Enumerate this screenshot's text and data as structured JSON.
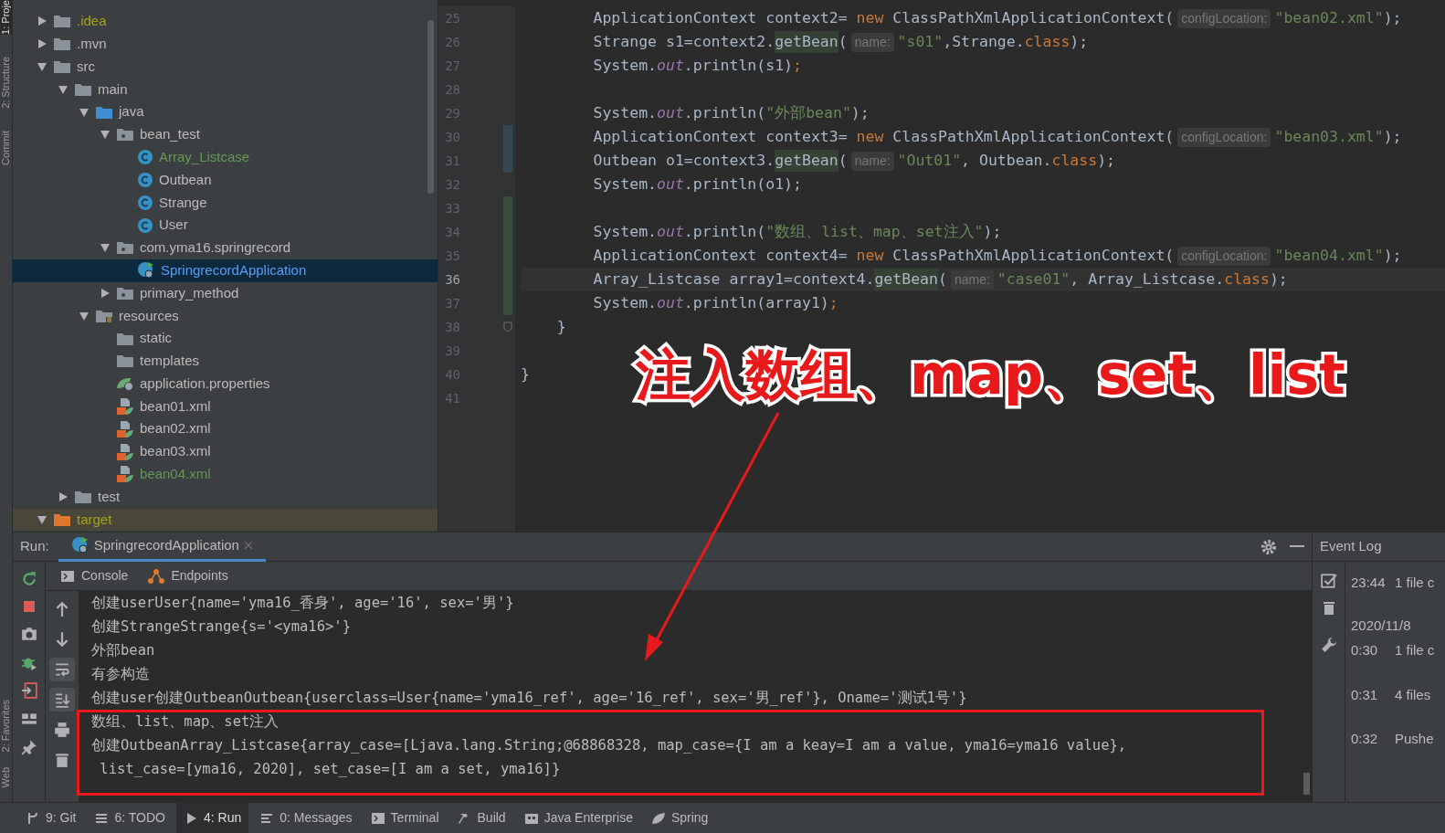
{
  "side_strip": {
    "top": [
      {
        "label": "1: Proje",
        "selected": true
      },
      {
        "label": "2: Structure",
        "selected": false
      },
      {
        "label": "Commit",
        "selected": false
      }
    ],
    "bottom": [
      {
        "label": "2: Favorites",
        "selected": false
      },
      {
        "label": "Web",
        "selected": false
      }
    ]
  },
  "project_tree": [
    {
      "label": ".idea",
      "kind": "folder",
      "color": "#a3a31d",
      "expanded": false,
      "selected": false
    },
    {
      "label": ".mvn",
      "kind": "folder",
      "color": "#bbbbbb",
      "expanded": false,
      "selected": false
    },
    {
      "label": "src",
      "kind": "folder",
      "color": "#bbbbbb",
      "expanded": true,
      "selected": false,
      "children": [
        {
          "label": "main",
          "kind": "folder",
          "color": "#bbbbbb",
          "expanded": true,
          "selected": false,
          "children": [
            {
              "label": "java",
              "kind": "source-folder",
              "color": "#bbbbbb",
              "expanded": true,
              "selected": false,
              "children": [
                {
                  "label": "bean_test",
                  "kind": "package",
                  "color": "#bbbbbb",
                  "expanded": true,
                  "selected": false,
                  "children": [
                    {
                      "label": "Array_Listcase",
                      "kind": "class",
                      "color": "#629755",
                      "selected": false
                    },
                    {
                      "label": "Outbean",
                      "kind": "class",
                      "color": "#bbbbbb",
                      "selected": false
                    },
                    {
                      "label": "Strange",
                      "kind": "class",
                      "color": "#bbbbbb",
                      "selected": false
                    },
                    {
                      "label": "User",
                      "kind": "class",
                      "color": "#bbbbbb",
                      "selected": false
                    }
                  ]
                },
                {
                  "label": "com.yma16.springrecord",
                  "kind": "package",
                  "color": "#bbbbbb",
                  "expanded": true,
                  "selected": false,
                  "children": [
                    {
                      "label": "SpringrecordApplication",
                      "kind": "spring-app",
                      "selected": true
                    }
                  ]
                },
                {
                  "label": "primary_method",
                  "kind": "package",
                  "color": "#bbbbbb",
                  "expanded": false,
                  "selected": false
                }
              ]
            },
            {
              "label": "resources",
              "kind": "resources-folder",
              "color": "#bbbbbb",
              "expanded": true,
              "selected": false,
              "children": [
                {
                  "label": "static",
                  "kind": "folder",
                  "color": "#bbbbbb",
                  "selected": false
                },
                {
                  "label": "templates",
                  "kind": "folder",
                  "color": "#bbbbbb",
                  "selected": false
                },
                {
                  "label": "application.properties",
                  "kind": "spring-properties",
                  "color": "#bbbbbb",
                  "selected": false
                },
                {
                  "label": "bean01.xml",
                  "kind": "xml",
                  "color": "#bbbbbb",
                  "selected": false
                },
                {
                  "label": "bean02.xml",
                  "kind": "xml",
                  "color": "#bbbbbb",
                  "selected": false
                },
                {
                  "label": "bean03.xml",
                  "kind": "xml",
                  "color": "#bbbbbb",
                  "selected": false
                },
                {
                  "label": "bean04.xml",
                  "kind": "xml",
                  "color": "#629755",
                  "selected": false
                }
              ]
            }
          ]
        },
        {
          "label": "test",
          "kind": "folder",
          "color": "#bbbbbb",
          "expanded": false,
          "selected": false
        }
      ]
    },
    {
      "label": "target",
      "kind": "excluded-folder",
      "color": "#a3a31d",
      "expanded": true,
      "selected": false
    }
  ],
  "editor": {
    "lines": [
      {
        "number": "25",
        "current": false,
        "modified": false,
        "added": false,
        "fold": false,
        "segments": [
          {
            "text": "        ApplicationContext context2= ",
            "kind": "plain"
          },
          {
            "text": "new",
            "kind": "keyword"
          },
          {
            "text": " ClassPathXmlApplicationContext(",
            "kind": "plain"
          },
          {
            "text": "configLocation:",
            "kind": "hint"
          },
          {
            "text": "\"bean02.xml\"",
            "kind": "string"
          },
          {
            "text": ");",
            "kind": "plain"
          }
        ]
      },
      {
        "number": "26",
        "current": false,
        "modified": false,
        "added": false,
        "fold": false,
        "segments": [
          {
            "text": "        Strange s1=context2.",
            "kind": "plain"
          },
          {
            "text": "getBean",
            "kind": "usage"
          },
          {
            "text": "(",
            "kind": "plain"
          },
          {
            "text": "name:",
            "kind": "hint"
          },
          {
            "text": "\"s01\"",
            "kind": "string"
          },
          {
            "text": ",Strange.",
            "kind": "plain"
          },
          {
            "text": "class",
            "kind": "keyword"
          },
          {
            "text": ");",
            "kind": "plain"
          }
        ]
      },
      {
        "number": "27",
        "current": false,
        "modified": false,
        "added": false,
        "fold": false,
        "segments": [
          {
            "text": "        System.",
            "kind": "plain"
          },
          {
            "text": "out",
            "kind": "field"
          },
          {
            "text": ".println(s1)",
            "kind": "plain"
          },
          {
            "text": ";",
            "kind": "keyword"
          }
        ]
      },
      {
        "number": "28",
        "current": false,
        "modified": false,
        "added": false,
        "fold": false
      },
      {
        "number": "29",
        "current": false,
        "modified": false,
        "added": false,
        "fold": false,
        "segments": [
          {
            "text": "        System.",
            "kind": "plain"
          },
          {
            "text": "out",
            "kind": "field"
          },
          {
            "text": ".println(",
            "kind": "plain"
          },
          {
            "text": "\"外部bean\"",
            "kind": "string"
          },
          {
            "text": ");",
            "kind": "plain"
          }
        ]
      },
      {
        "number": "30",
        "current": false,
        "modified": true,
        "added": false,
        "fold": false,
        "segments": [
          {
            "text": "        ApplicationContext context3= ",
            "kind": "plain"
          },
          {
            "text": "new",
            "kind": "keyword"
          },
          {
            "text": " ClassPathXmlApplicationContext(",
            "kind": "plain"
          },
          {
            "text": "configLocation:",
            "kind": "hint"
          },
          {
            "text": "\"bean03.xml\"",
            "kind": "string"
          },
          {
            "text": ");",
            "kind": "plain"
          }
        ]
      },
      {
        "number": "31",
        "current": false,
        "modified": true,
        "added": false,
        "fold": false,
        "segments": [
          {
            "text": "        Outbean o1=context3.",
            "kind": "plain"
          },
          {
            "text": "getBean",
            "kind": "usage"
          },
          {
            "text": "(",
            "kind": "plain"
          },
          {
            "text": "name:",
            "kind": "hint"
          },
          {
            "text": "\"Out01\"",
            "kind": "string"
          },
          {
            "text": ", Outbean.",
            "kind": "plain"
          },
          {
            "text": "class",
            "kind": "keyword"
          },
          {
            "text": ");",
            "kind": "plain"
          }
        ]
      },
      {
        "number": "32",
        "current": false,
        "modified": false,
        "added": false,
        "fold": false,
        "segments": [
          {
            "text": "        System.",
            "kind": "plain"
          },
          {
            "text": "out",
            "kind": "field"
          },
          {
            "text": ".println(o1);",
            "kind": "plain"
          }
        ]
      },
      {
        "number": "33",
        "current": false,
        "modified": false,
        "added": true,
        "fold": false
      },
      {
        "number": "34",
        "current": false,
        "modified": false,
        "added": true,
        "fold": false,
        "segments": [
          {
            "text": "        System.",
            "kind": "plain"
          },
          {
            "text": "out",
            "kind": "field"
          },
          {
            "text": ".println(",
            "kind": "plain"
          },
          {
            "text": "\"数组、list、map、set注入\"",
            "kind": "string"
          },
          {
            "text": ");",
            "kind": "plain"
          }
        ]
      },
      {
        "number": "35",
        "current": false,
        "modified": false,
        "added": true,
        "fold": false,
        "segments": [
          {
            "text": "        ApplicationContext context4= ",
            "kind": "plain"
          },
          {
            "text": "new",
            "kind": "keyword"
          },
          {
            "text": " ClassPathXmlApplicationContext(",
            "kind": "plain"
          },
          {
            "text": "configLocation:",
            "kind": "hint"
          },
          {
            "text": "\"bean04.xml\"",
            "kind": "string"
          },
          {
            "text": ");",
            "kind": "plain"
          }
        ]
      },
      {
        "number": "36",
        "current": true,
        "modified": false,
        "added": true,
        "fold": false,
        "segments": [
          {
            "text": "        Array_Listcase array1=context4.",
            "kind": "plain"
          },
          {
            "text": "getBean",
            "kind": "usage"
          },
          {
            "text": "(",
            "kind": "plain"
          },
          {
            "text": "name:",
            "kind": "hint"
          },
          {
            "text": "\"case01\"",
            "kind": "string"
          },
          {
            "text": ", Array_Listcase.",
            "kind": "plain"
          },
          {
            "text": "class",
            "kind": "keyword"
          },
          {
            "text": ");",
            "kind": "plain"
          }
        ]
      },
      {
        "number": "37",
        "current": false,
        "modified": false,
        "added": true,
        "fold": false,
        "segments": [
          {
            "text": "        System.",
            "kind": "plain"
          },
          {
            "text": "out",
            "kind": "field"
          },
          {
            "text": ".println(array1)",
            "kind": "plain"
          },
          {
            "text": ";",
            "kind": "keyword"
          }
        ]
      },
      {
        "number": "38",
        "current": false,
        "modified": false,
        "added": false,
        "fold": true,
        "segments": [
          {
            "text": "    }",
            "kind": "plain"
          }
        ]
      },
      {
        "number": "39",
        "current": false,
        "modified": false,
        "added": false,
        "fold": false
      },
      {
        "number": "40",
        "current": false,
        "modified": false,
        "added": false,
        "fold": false,
        "segments": [
          {
            "text": "}",
            "kind": "plain"
          }
        ]
      },
      {
        "number": "41",
        "current": false,
        "modified": false,
        "added": false,
        "fold": false
      }
    ]
  },
  "annotation": {
    "title": "注入数组、map、set、list"
  },
  "run_panel": {
    "label": "Run:",
    "tab": "SpringrecordApplication",
    "subtabs": [
      {
        "label": "Console",
        "kind": "console"
      },
      {
        "label": "Endpoints",
        "kind": "endpoints"
      }
    ],
    "console_lines": [
      "创建userUser{name='yma16_香身', age='16', sex='男'}",
      "创建StrangeStrange{s='<yma16>'}",
      "外部bean",
      "有参构造",
      "创建user创建OutbeanOutbean{userclass=User{name='yma16_ref', age='16_ref', sex='男_ref'}, Oname='测试1号'}",
      "数组、list、map、set注入",
      "创建OutbeanArray_Listcase{array_case=[Ljava.lang.String;@68868328, map_case={I am a keay=I am a value, yma16=yma16 value},",
      " list_case=[yma16, 2020], set_case=[I am a set, yma16]}"
    ],
    "toolbar_right": [
      {
        "kind": "up",
        "on": false
      },
      {
        "kind": "down",
        "on": false
      },
      {
        "kind": "wrap",
        "on": true
      },
      {
        "kind": "scroll-end",
        "on": true
      },
      {
        "kind": "print",
        "on": false
      },
      {
        "kind": "trash",
        "on": false
      }
    ]
  },
  "event_log": {
    "title": "Event Log",
    "entries": [
      {
        "time": "23:44",
        "text": "1 file c"
      },
      {
        "time": "2020/11/8"
      },
      {
        "time": "0:30",
        "text": "1 file c"
      },
      {
        "time": "0:31",
        "text": "4 files"
      },
      {
        "time": "0:32",
        "text": "Pushe"
      }
    ]
  },
  "status_bar": [
    {
      "label": "9: Git",
      "kind": "git",
      "selected": false
    },
    {
      "label": "6: TODO",
      "kind": "list",
      "selected": false
    },
    {
      "label": "4: Run",
      "kind": "run",
      "selected": true
    },
    {
      "label": "0: Messages",
      "kind": "messages",
      "selected": false
    },
    {
      "label": "Terminal",
      "kind": "terminal",
      "selected": false
    },
    {
      "label": "Build",
      "kind": "hammer",
      "selected": false
    },
    {
      "label": "Java Enterprise",
      "kind": "enterprise",
      "selected": false
    },
    {
      "label": "Spring",
      "kind": "leaf",
      "selected": false
    }
  ]
}
